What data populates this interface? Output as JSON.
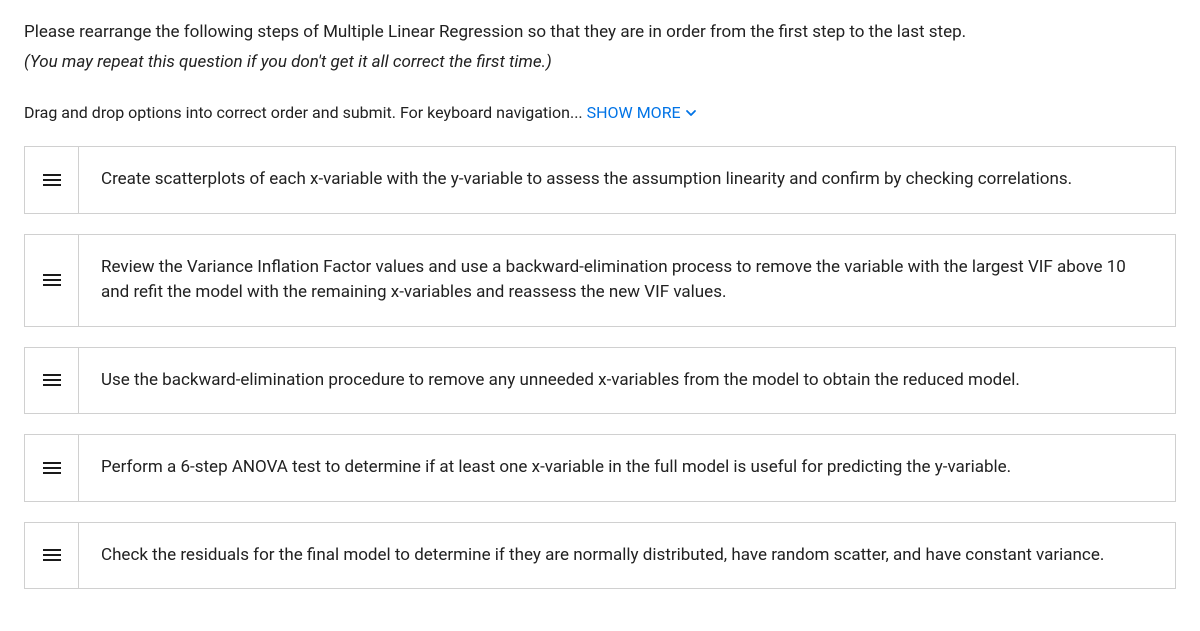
{
  "question": {
    "prompt": "Please rearrange the following steps of Multiple Linear Regression so that they are in order from the first step to the last step.",
    "note": "(You may repeat this question if you don't get it all correct the first time.)"
  },
  "instruction": {
    "text": "Drag and drop options into correct order and submit. For keyboard navigation... ",
    "show_more_label": "SHOW MORE"
  },
  "items": [
    {
      "text": "Create scatterplots of each x-variable with the y-variable to assess the assumption linearity and confirm by checking correlations."
    },
    {
      "text": "Review the Variance Inflation Factor values and use a backward-elimination process to remove the variable with the largest VIF above 10 and refit the model with the remaining x-variables and reassess the new VIF values."
    },
    {
      "text": "Use the backward-elimination procedure to remove any unneeded x-variables from the model to obtain the reduced model."
    },
    {
      "text": "Perform a 6-step ANOVA test to determine if at least one x-variable in the full model is useful for predicting the y-variable."
    },
    {
      "text": "Check the residuals for the final model to determine if they are normally distributed, have random scatter, and have constant variance."
    }
  ]
}
